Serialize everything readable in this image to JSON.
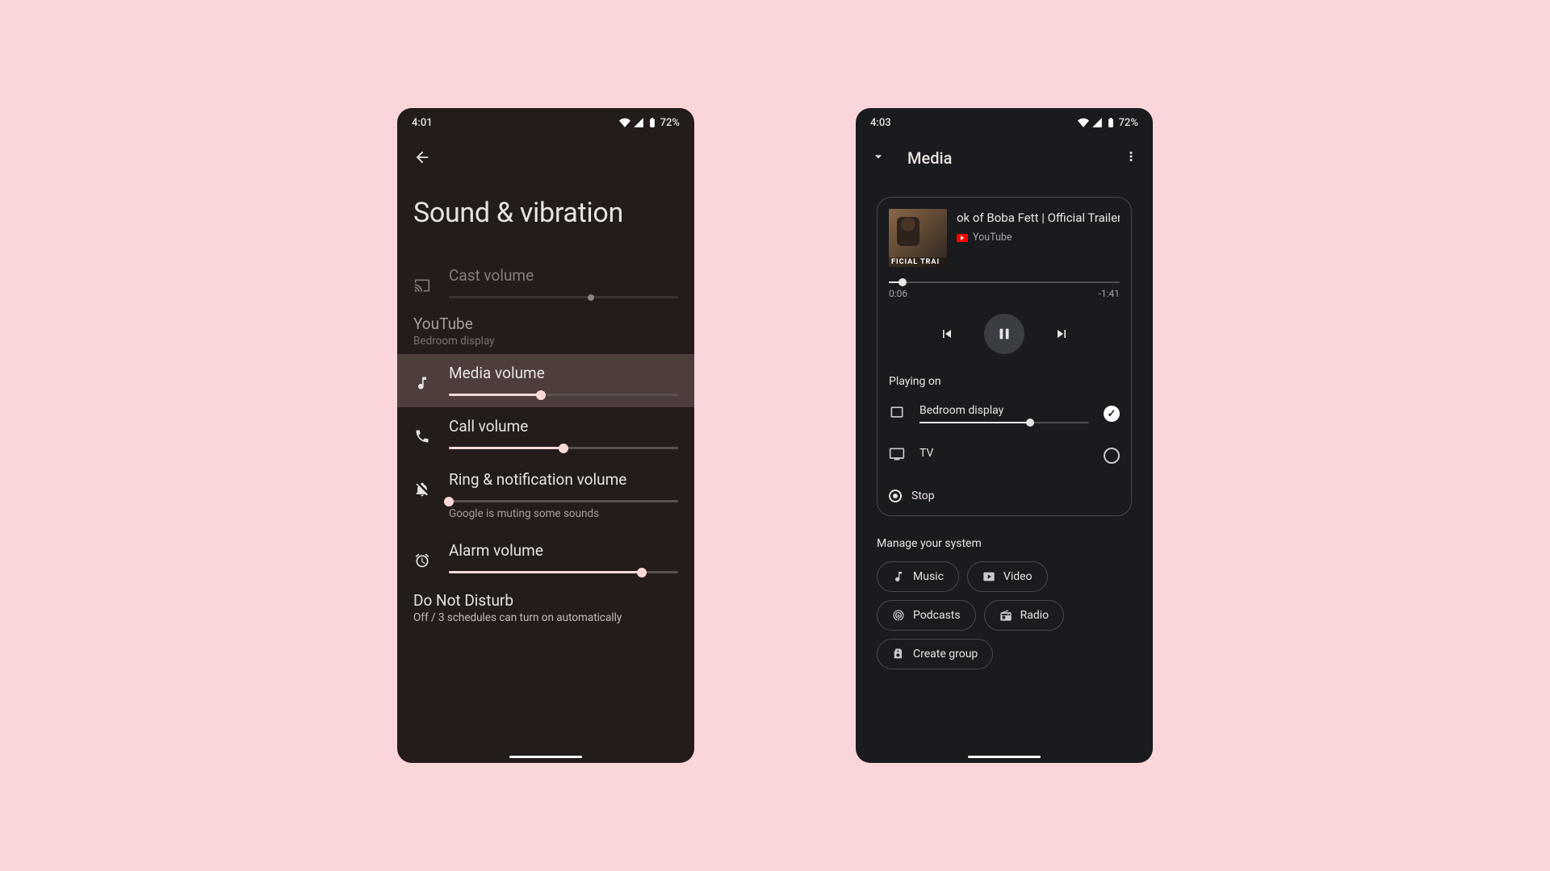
{
  "phone_a": {
    "status": {
      "time": "4:01",
      "battery": "72%"
    },
    "title": "Sound & vibration",
    "cast": {
      "label": "Cast volume",
      "value_pct": 62
    },
    "app_section": {
      "app": "YouTube",
      "device": "Bedroom display"
    },
    "media": {
      "label": "Media volume",
      "value_pct": 40
    },
    "call": {
      "label": "Call volume",
      "value_pct": 50
    },
    "ring": {
      "label": "Ring & notification volume",
      "value_pct": 0,
      "muting_note": "Google is muting some sounds"
    },
    "alarm": {
      "label": "Alarm volume",
      "value_pct": 84
    },
    "dnd": {
      "title": "Do Not Disturb",
      "sub": "Off / 3 schedules can turn on automatically"
    }
  },
  "phone_b": {
    "status": {
      "time": "4:03",
      "battery": "72%"
    },
    "header_title": "Media",
    "now_playing": {
      "title": "ok of Boba Fett | Official Trailer",
      "source": "YouTube",
      "thumb_badge": "FICIAL TRAI",
      "elapsed": "0:06",
      "remaining": "-1:41",
      "progress_pct": 6
    },
    "playing_on_label": "Playing on",
    "devices": [
      {
        "name": "Bedroom display",
        "volume_pct": 65,
        "selected": true,
        "kind": "tablet"
      },
      {
        "name": "TV",
        "selected": false,
        "kind": "tv"
      }
    ],
    "stop_label": "Stop",
    "manage_label": "Manage your system",
    "chips": [
      "Music",
      "Video",
      "Podcasts",
      "Radio",
      "Create group"
    ]
  }
}
